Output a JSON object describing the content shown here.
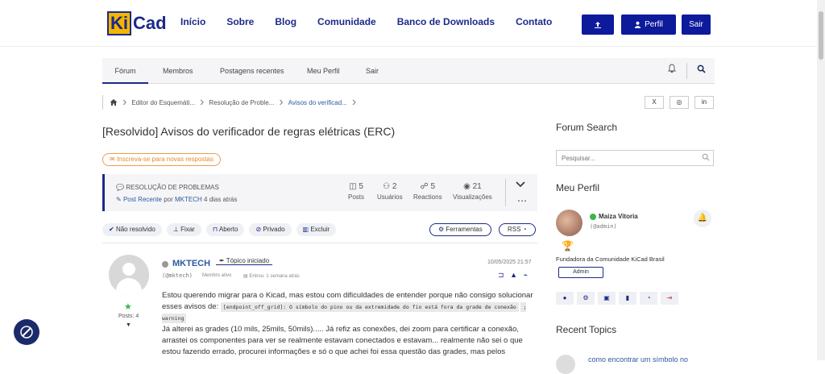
{
  "brand": {
    "ki": "Ki",
    "cad": "Cad"
  },
  "menu": [
    "Início",
    "Sobre",
    "Blog",
    "Comunidade",
    "Banco de Downloads",
    "Contato"
  ],
  "topbuttons": {
    "upload_icon": "upload-icon",
    "profile": "Perfil",
    "logout": "Sair"
  },
  "forumnav": {
    "tabs": [
      "Fórum",
      "Membros",
      "Postagens recentes",
      "Meu Perfil",
      "Sair"
    ],
    "active": "Fórum"
  },
  "breadcrumbs": [
    "Editor do Esquemáti...",
    "Resolução de Proble...",
    "Avisos do verificad..."
  ],
  "social": [
    "X",
    "◎",
    "in"
  ],
  "topic": {
    "title": "[Resolvido] Avisos do verificador de regras elétricas (ERC)",
    "subscribe": "Inscreva-se para novas respostas",
    "category": "RESOLUÇÃO DE PROBLEMAS",
    "recent_label": "Post Recente",
    "recent_by": "por",
    "recent_author": "MKTECH",
    "recent_time": "4 dias atrás",
    "stats": [
      {
        "num": "5",
        "label": "Posts"
      },
      {
        "num": "2",
        "label": "Usuários"
      },
      {
        "num": "5",
        "label": "Reactions"
      },
      {
        "num": "21",
        "label": "Visualizações"
      }
    ]
  },
  "actions": [
    "Não resolvido",
    "Fixar",
    "Aberto",
    "Privado",
    "Excluir"
  ],
  "tools": {
    "ferramentas": "Ferramentas",
    "rss": "RSS"
  },
  "post": {
    "author": "MKTECH",
    "badge": "Tópico iniciado",
    "handle": "(@mktech)",
    "status": "Membro ativo",
    "joined": "Entrou: 1 semana atrás",
    "date": "10/05/2025 21:57",
    "posts": "Posts: 4",
    "p1": "Estou querendo migrar para o Kicad, mas estou com dificuldades de entender porque não consigo solucionar esses avisos de:",
    "code1": "[endpoint_off_grid]: O símbolo do pino ou da extremidade do fio está fora da grade de conexão",
    "code2": "; warning",
    "p2": "Já alterei as grades (10 mils, 25mils, 50mils)..... Já refiz as conexões, dei zoom para certificar a conexão, arrastei os componentes para ver se realmente estavam conectados e estavam... realmente não sei o que estou fazendo errado, procurei informações e só o que achei foi essa questão das grades, mas pelos"
  },
  "sidebar": {
    "search_title": "Forum Search",
    "search_placeholder": "Pesquisar...",
    "profile_title": "Meu Perfil",
    "user_name": "Maiza Vitoria",
    "user_handle": "(@admin)",
    "founder": "Fundadora da Comunidade KiCad Brasil",
    "role": "Admin",
    "recent_title": "Recent Topics",
    "recent_item": "como encontrar um símbolo no"
  }
}
